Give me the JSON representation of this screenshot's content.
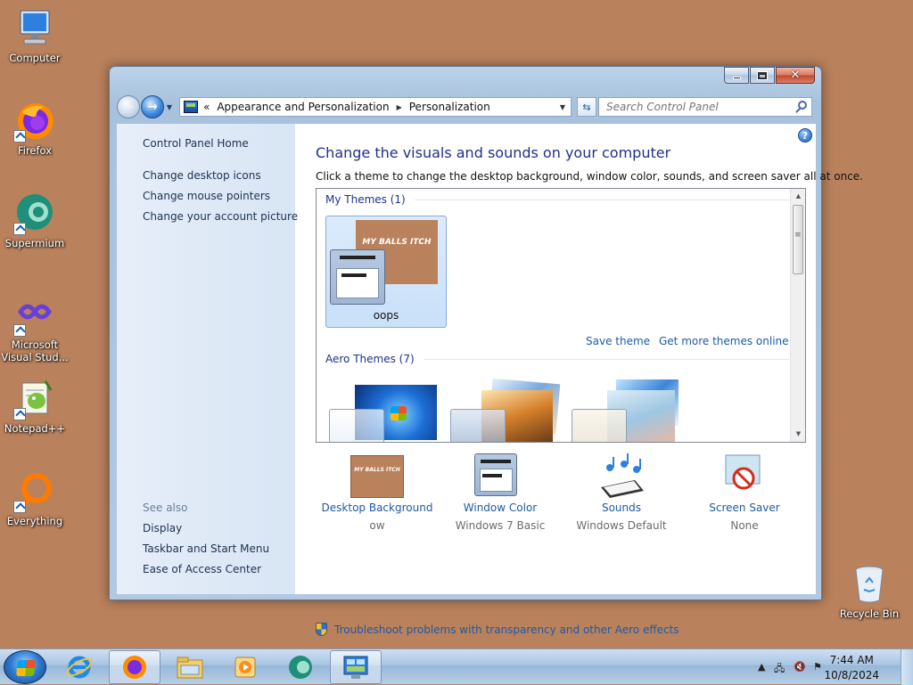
{
  "desktop": {
    "icons": [
      {
        "label": "Computer"
      },
      {
        "label": "Firefox"
      },
      {
        "label": "Supermium"
      },
      {
        "label": "Microsoft Visual Stud..."
      },
      {
        "label": "Notepad++"
      },
      {
        "label": "Everything"
      },
      {
        "label": "Recycle Bin"
      }
    ]
  },
  "window": {
    "address": {
      "overflow": "«",
      "crumbs": [
        "Appearance and Personalization",
        "Personalization"
      ]
    },
    "search_placeholder": "Search Control Panel",
    "left_nav": {
      "home": "Control Panel Home",
      "links": [
        "Change desktop icons",
        "Change mouse pointers",
        "Change your account picture"
      ],
      "see_also_heading": "See also",
      "see_also": [
        "Display",
        "Taskbar and Start Menu",
        "Ease of Access Center"
      ]
    },
    "heading": "Change the visuals and sounds on your computer",
    "subheading": "Click a theme to change the desktop background, window color, sounds, and screen saver all at once.",
    "gallery": {
      "my_themes_header": "My Themes (1)",
      "my_theme": {
        "name": "oops",
        "wallpaper_text": "MY BALLS ITCH",
        "color": "#b9815c"
      },
      "save_theme": "Save theme",
      "get_more": "Get more themes online",
      "aero_themes_header": "Aero Themes (7)"
    },
    "options": [
      {
        "label": "Desktop Background",
        "value": "ow",
        "preview_text": "MY BALLS ITCH"
      },
      {
        "label": "Window Color",
        "value": "Windows 7 Basic"
      },
      {
        "label": "Sounds",
        "value": "Windows Default"
      },
      {
        "label": "Screen Saver",
        "value": "None"
      }
    ],
    "troubleshoot": "Troubleshoot problems with transparency and other Aero effects"
  },
  "taskbar": {
    "time": "7:44 AM",
    "date": "10/8/2024"
  },
  "colors": {
    "desktop": "#b9815c",
    "link": "#1e5aa8",
    "heading": "#1e3287"
  }
}
